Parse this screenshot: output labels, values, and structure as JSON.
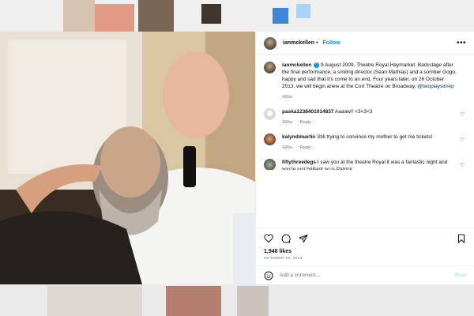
{
  "colors": {
    "accent": "#0095f6",
    "muted": "#737373",
    "link": "#00376b"
  },
  "header": {
    "username": "ianmckellen",
    "follow_label": "Follow",
    "separator": "•",
    "more_icon": "more-horizontal-icon"
  },
  "caption": {
    "username": "ianmckellen",
    "text": "9 August 2009, Theatre Royal Haymarket. Backstage after the final performance, a smiling director (Sean Mathias) and a somber Gogo, happy and sad that it's come to an end. Four years later, on 26 October 2013, we will begin anew at the Cort Theatre on Broadway. ",
    "mention": "@twoplaysinrep",
    "age": "426w"
  },
  "comments": [
    {
      "username": "paska1238401014837",
      "text": "Aaaaw!! <3<3<3",
      "age": "426w",
      "reply": "Reply"
    },
    {
      "username": "kalyndimartin",
      "text": "Still trying to convince my mother to get me tickets!",
      "age": "426w",
      "reply": "Reply"
    },
    {
      "username": "fiftythreedegs",
      "text": "I saw you at the theatre Royal it was a fantastic night and you're just brilliant so is Patrick",
      "age": "",
      "reply": ""
    }
  ],
  "actions": [
    "heart-icon",
    "comment-icon",
    "share-icon",
    "bookmark-icon"
  ],
  "likes": "1,948 likes",
  "date": "OCTOBER 16, 2013",
  "add_comment": {
    "emoji_icon": "emoji-icon",
    "placeholder": "Add a comment…",
    "post_label": "Post"
  }
}
